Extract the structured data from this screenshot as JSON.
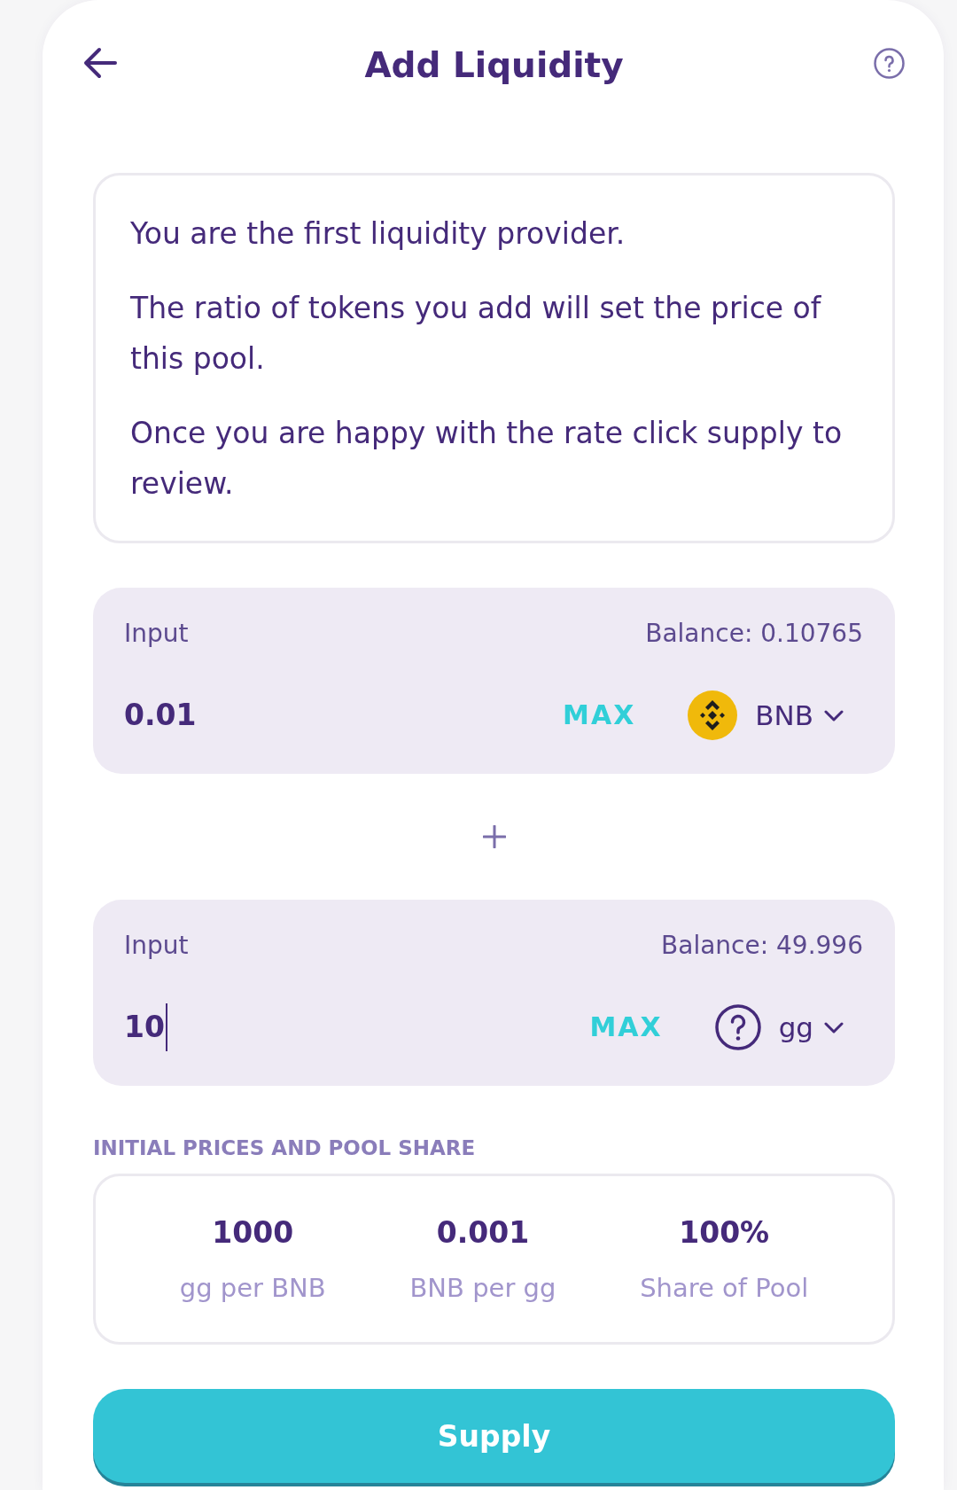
{
  "header": {
    "title": "Add Liquidity"
  },
  "notice": {
    "paragraphs": [
      "You are the first liquidity provider.",
      "The ratio of tokens you add will set the price of this pool.",
      "Once you are happy with the rate click supply to review."
    ]
  },
  "inputs": [
    {
      "label": "Input",
      "balance": "Balance: 0.10765",
      "value": "0.01",
      "focused": false,
      "max_label": "MAX",
      "token": {
        "symbol": "BNB",
        "kind": "coin"
      }
    },
    {
      "label": "Input",
      "balance": "Balance: 49.996",
      "value": "10",
      "focused": true,
      "max_label": "MAX",
      "token": {
        "symbol": "gg",
        "kind": "unknown"
      }
    }
  ],
  "prices": {
    "title": "INITIAL PRICES AND POOL SHARE",
    "items": [
      {
        "value": "1000",
        "label": "gg per BNB"
      },
      {
        "value": "0.001",
        "label": "BNB per gg"
      },
      {
        "value": "100%",
        "label": "Share of Pool"
      }
    ]
  },
  "supply_button": {
    "label": "Supply"
  }
}
